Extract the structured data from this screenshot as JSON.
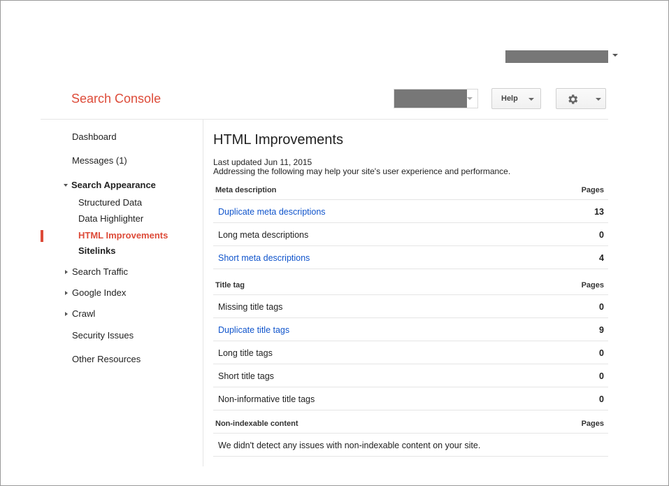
{
  "header": {
    "brand": "Search Console",
    "help_label": "Help"
  },
  "sidebar": {
    "items": [
      {
        "label": "Dashboard"
      },
      {
        "label": "Messages (1)"
      },
      {
        "label": "Search Appearance"
      },
      {
        "label": "Structured Data"
      },
      {
        "label": "Data Highlighter"
      },
      {
        "label": "HTML Improvements"
      },
      {
        "label": "Sitelinks"
      },
      {
        "label": "Search Traffic"
      },
      {
        "label": "Google Index"
      },
      {
        "label": "Crawl"
      },
      {
        "label": "Security Issues"
      },
      {
        "label": "Other Resources"
      }
    ]
  },
  "main": {
    "title": "HTML Improvements",
    "updated": "Last updated Jun 11, 2015",
    "subtitle": "Addressing the following may help your site's user experience and performance.",
    "sections": [
      {
        "heading": "Meta description",
        "pages_label": "Pages",
        "rows": [
          {
            "label": "Duplicate meta descriptions",
            "count": "13"
          },
          {
            "label": "Long meta descriptions",
            "count": "0"
          },
          {
            "label": "Short meta descriptions",
            "count": "4"
          }
        ]
      },
      {
        "heading": "Title tag",
        "pages_label": "Pages",
        "rows": [
          {
            "label": "Missing title tags",
            "count": "0"
          },
          {
            "label": "Duplicate title tags",
            "count": "9"
          },
          {
            "label": "Long title tags",
            "count": "0"
          },
          {
            "label": "Short title tags",
            "count": "0"
          },
          {
            "label": "Non-informative title tags",
            "count": "0"
          }
        ]
      },
      {
        "heading": "Non-indexable content",
        "pages_label": "Pages",
        "message": "We didn't detect any issues with non-indexable content on your site."
      }
    ]
  },
  "colors": {
    "brand": "#dd4b39",
    "link": "#1155cc",
    "divider": "#e5e5e5"
  }
}
